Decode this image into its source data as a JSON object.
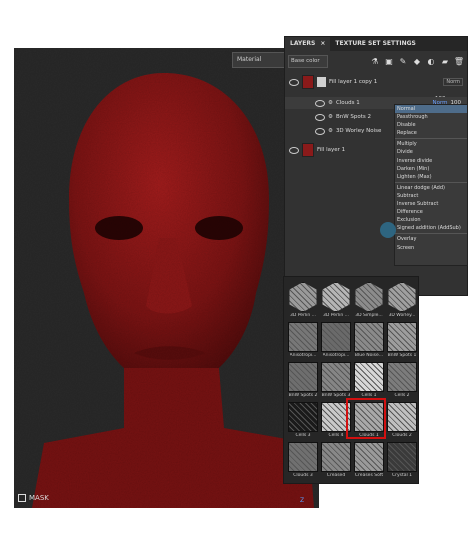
{
  "viewport": {
    "material_select": "Material",
    "mask_label": "MASK",
    "gizmo_axis": "Z",
    "skin_color": "#8b1616"
  },
  "layers_panel": {
    "tabs": [
      "LAYERS",
      "TEXTURE SET SETTINGS"
    ],
    "close_glyph": "×",
    "channel_select": "Base color",
    "rows": [
      {
        "name": "Fill layer 1 copy 1",
        "blend": "Norm",
        "opacity": "100"
      },
      {
        "name": "Clouds 1",
        "blend": "Norm",
        "opacity": "100"
      },
      {
        "name": "BnW Spots 2"
      },
      {
        "name": "3D Worley Noise"
      },
      {
        "name": "Fill layer 1"
      }
    ],
    "blend_menu": [
      [
        "Normal",
        "Passthrough",
        "Disable",
        "Replace"
      ],
      [
        "Multiply",
        "Divide",
        "Inverse divide",
        "Darken (Min)",
        "Lighten (Max)"
      ],
      [
        "Linear dodge (Add)",
        "Subtract",
        "Inverse Subtract",
        "Difference",
        "Exclusion",
        "Signed addition (AddSub)"
      ],
      [
        "Overlay",
        "Screen"
      ]
    ]
  },
  "texture_browser": {
    "items": [
      {
        "label": "3D Perlin ...",
        "color": "#9a9a9a",
        "hex": true
      },
      {
        "label": "3D Perlin ...",
        "color": "#b5b5b5",
        "hex": true
      },
      {
        "label": "3D Simple...",
        "color": "#8c8c8c",
        "hex": true
      },
      {
        "label": "3D Worley...",
        "color": "#a0a0a0",
        "hex": true
      },
      {
        "label": "Anisotropi...",
        "color": "#777777",
        "hex": false
      },
      {
        "label": "Anisotropi...",
        "color": "#6a6a6a",
        "hex": false
      },
      {
        "label": "Blue Noise...",
        "color": "#8a8a8a",
        "hex": false
      },
      {
        "label": "BnW Spots 1",
        "color": "#9d9d9d",
        "hex": false
      },
      {
        "label": "BnW Spots 2",
        "color": "#6e6e6e",
        "hex": false
      },
      {
        "label": "BnW Spots 3",
        "color": "#858585",
        "hex": false
      },
      {
        "label": "Cells 1",
        "color": "#d8d8d8",
        "hex": false
      },
      {
        "label": "Cells 2",
        "color": "#7c7c7c",
        "hex": false
      },
      {
        "label": "Cells 3",
        "color": "#1a1a1a",
        "hex": false
      },
      {
        "label": "Cells 4",
        "color": "#c9c9c9",
        "hex": false
      },
      {
        "label": "Clouds 1",
        "color": "#a9a9a9",
        "hex": false
      },
      {
        "label": "Clouds 2",
        "color": "#c0c0c0",
        "hex": false
      },
      {
        "label": "Clouds 3",
        "color": "#707070",
        "hex": false
      },
      {
        "label": "Creased",
        "color": "#888888",
        "hex": false
      },
      {
        "label": "Creases Soft",
        "color": "#9a9a9a",
        "hex": false
      },
      {
        "label": "Crystal 1",
        "color": "#3a3a3a",
        "hex": false
      }
    ],
    "highlight_color": "#d21010"
  }
}
